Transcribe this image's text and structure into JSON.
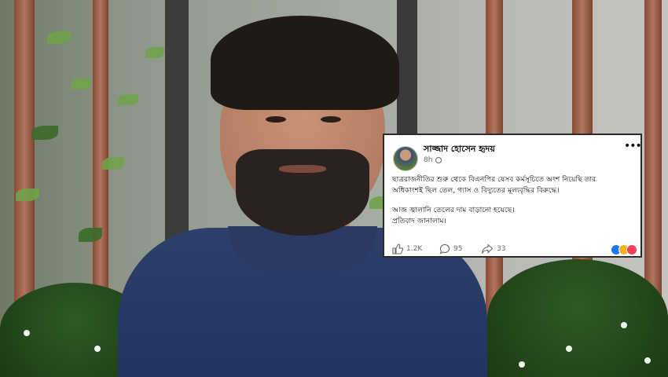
{
  "post": {
    "author": "সাজ্জাদ হোসেন হৃদয়",
    "time": "8h",
    "menu_icon": "more-options-icon",
    "lines": [
      "ছাত্ররাজনীতির শুরু থেকে বিএনপির যেসব কর্মসূচিতে অংশ নিয়েছি তার",
      "অধিকাংশই ছিল তেল, গ্যাস ও বিদ্যুতের মূল্যবৃদ্ধির বিরুদ্ধে।",
      "আজ জ্বালানি তেলের দাম বাড়ানো হয়েছে।",
      "প্রতিবাদ জানালাম।"
    ],
    "likes": "1.2K",
    "comments": "95",
    "shares": "33",
    "reactions": [
      "like",
      "sad",
      "love"
    ],
    "colors": {
      "like": "#1877f2",
      "sad": "#f7b125",
      "love": "#f33e58"
    }
  }
}
